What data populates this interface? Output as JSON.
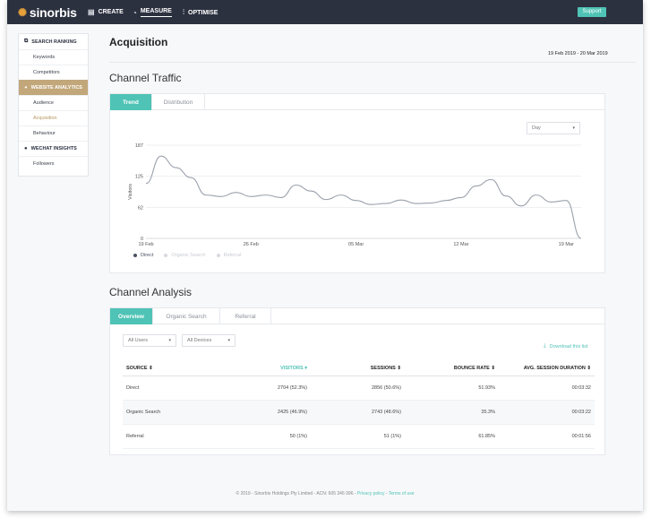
{
  "app": {
    "logo": "sinorbis",
    "support_label": "Support"
  },
  "nav": [
    {
      "label": "CREATE",
      "icon": "document-icon"
    },
    {
      "label": "MEASURE",
      "icon": "gauge-icon",
      "active": true
    },
    {
      "label": "OPTIMISE",
      "icon": "sliders-icon"
    }
  ],
  "sidebar": {
    "groups": [
      {
        "label": "SEARCH RANKING",
        "icon": "search-ranking-icon",
        "items": [
          "Keywords",
          "Competitors"
        ]
      },
      {
        "label": "WEBSITE ANALYTICS",
        "icon": "analytics-icon",
        "active": true,
        "items": [
          "Audience",
          "Acquisition",
          "Behaviour"
        ],
        "active_item": "Acquisition"
      },
      {
        "label": "WECHAT INSIGHTS",
        "icon": "wechat-icon",
        "items": [
          "Followers"
        ]
      }
    ]
  },
  "page": {
    "title": "Acquisition",
    "date_range": "19 Feb 2019 - 20 Mar 2019"
  },
  "channel_traffic": {
    "title": "Channel Traffic",
    "tabs": [
      "Trend",
      "Distribution"
    ],
    "active_tab": "Trend",
    "granularity": "Day"
  },
  "chart_data": {
    "type": "line",
    "ylabel": "Visitors",
    "yticks": [
      0,
      62,
      125,
      187
    ],
    "ylim": [
      0,
      187
    ],
    "xticks": [
      "19 Feb",
      "26 Feb",
      "05 Mar",
      "12 Mar",
      "19 Mar"
    ],
    "x": [
      "19 Feb",
      "20 Feb",
      "21 Feb",
      "22 Feb",
      "23 Feb",
      "24 Feb",
      "25 Feb",
      "26 Feb",
      "27 Feb",
      "28 Feb",
      "01 Mar",
      "02 Mar",
      "03 Mar",
      "04 Mar",
      "05 Mar",
      "06 Mar",
      "07 Mar",
      "08 Mar",
      "09 Mar",
      "10 Mar",
      "11 Mar",
      "12 Mar",
      "13 Mar",
      "14 Mar",
      "15 Mar",
      "16 Mar",
      "17 Mar",
      "18 Mar",
      "19 Mar",
      "20 Mar"
    ],
    "series": [
      {
        "name": "Direct",
        "color": "#9aa0ab",
        "values": [
          110,
          165,
          142,
          122,
          87,
          84,
          92,
          84,
          87,
          82,
          107,
          95,
          78,
          87,
          76,
          68,
          70,
          77,
          70,
          71,
          76,
          82,
          105,
          118,
          85,
          65,
          87,
          73,
          76,
          0
        ]
      }
    ],
    "legend": [
      {
        "name": "Direct",
        "color": "#4a5160",
        "active": true
      },
      {
        "name": "Organic Search",
        "color": "#d7dadf",
        "active": false
      },
      {
        "name": "Referral",
        "color": "#d7dadf",
        "active": false
      }
    ],
    "grid": true
  },
  "channel_analysis": {
    "title": "Channel Analysis",
    "tabs": [
      "Overview",
      "Organic Search",
      "Referral"
    ],
    "active_tab": "Overview",
    "filters": [
      "All Users",
      "All Devices"
    ],
    "download_label": "Download this list",
    "columns": [
      "SOURCE",
      "VISITORS",
      "SESSIONS",
      "BOUNCE RATE",
      "AVG. SESSION DURATION"
    ],
    "rows": [
      [
        "Direct",
        "2704 (52.3%)",
        "2856 (50.6%)",
        "51.93%",
        "00:03:32"
      ],
      [
        "Organic Search",
        "2425 (46.9%)",
        "2743 (48.6%)",
        "35.3%",
        "00:03:22"
      ],
      [
        "Referral",
        "50 (1%)",
        "51 (1%)",
        "61.85%",
        "00:01:56"
      ]
    ]
  },
  "footer": {
    "text": "© 2019 - Sinorbis Holdings Pty Limited - ACN: 605 346 996 -",
    "privacy": "Privacy policy",
    "sep": "-",
    "terms": "Terms of use"
  },
  "colors": {
    "accent": "#4fc3b5",
    "gold": "#c2a77a",
    "topbar": "#2c3140"
  }
}
